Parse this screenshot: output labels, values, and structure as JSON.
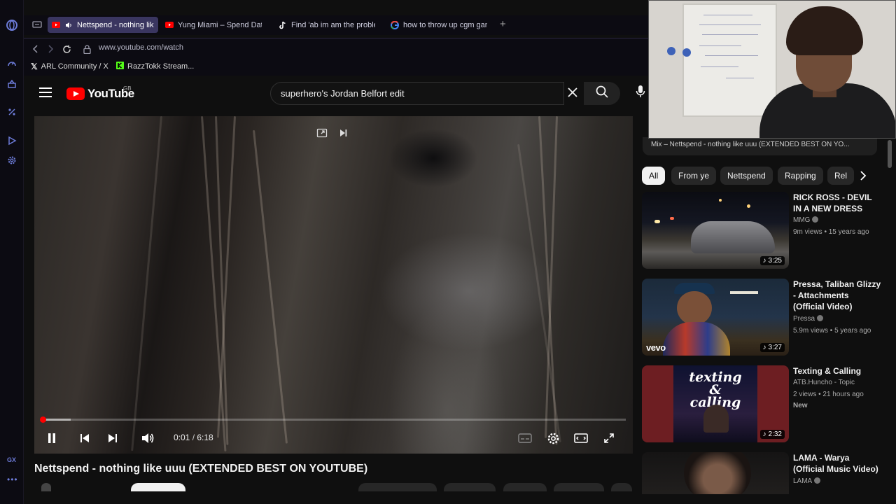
{
  "browser": {
    "tabs": [
      {
        "title": "Nettspend - nothing like uuu (EXTENDED BEST ON YOUTUBE)",
        "icon": "youtube-icon",
        "active": true,
        "audio": true
      },
      {
        "title": "Yung Miami – Spend Dat (L",
        "icon": "youtube-icon",
        "active": false
      },
      {
        "title": "Find 'ab im am the problem",
        "icon": "tiktok-icon",
        "active": false
      },
      {
        "title": "how to throw up cgm gang",
        "icon": "google-icon",
        "active": false
      }
    ],
    "address": "www.youtube.com/watch",
    "bookmarks": [
      {
        "label": "ARL Community / X",
        "icon": "x-icon"
      },
      {
        "label": "RazzTokk Stream...",
        "icon": "kick-icon"
      }
    ],
    "gx_label": "GX",
    "gx_more": "•••"
  },
  "youtube": {
    "logo": "YouTube",
    "country": "GB",
    "search_query": "superhero's Jordan Belfort edit",
    "player": {
      "current_time": "0:01",
      "separator": " / ",
      "duration": "6:18",
      "progress": 0.003
    },
    "video_title": "Nettspend - nothing like uuu (EXTENDED BEST ON YOUTUBE)",
    "mix_label": "Mix – Nettspend - nothing like uuu (EXTENDED BEST ON YO...",
    "chips": [
      "All",
      "From ye",
      "Nettspend",
      "Rapping",
      "Rel"
    ],
    "recommendations": [
      {
        "title": "RICK ROSS - DEVIL IN A NEW DRESS",
        "channel": "MMG",
        "verified": true,
        "stats": "9m views • 15 years ago",
        "duration": "3:25"
      },
      {
        "title": "Pressa, Taliban Glizzy - Attachments (Official Video)",
        "channel": "Pressa",
        "verified": true,
        "stats": "5.9m views • 5 years ago",
        "duration": "3:27",
        "watermark": "vevo"
      },
      {
        "title": "Texting & Calling",
        "channel": "ATB.Huncho - Topic",
        "verified": false,
        "stats": "2 views • 21 hours ago",
        "badge": "New",
        "duration": "2:32",
        "thumb_text": "texting & calling"
      },
      {
        "title": "LAMA - Warya (Official Music Video)",
        "channel": "LAMA",
        "verified": true,
        "stats": "",
        "duration": ""
      }
    ]
  },
  "colors": {
    "accent_red": "#ff0000",
    "opera_accent": "#6c7bd8",
    "active_tab": "#3a3660"
  }
}
